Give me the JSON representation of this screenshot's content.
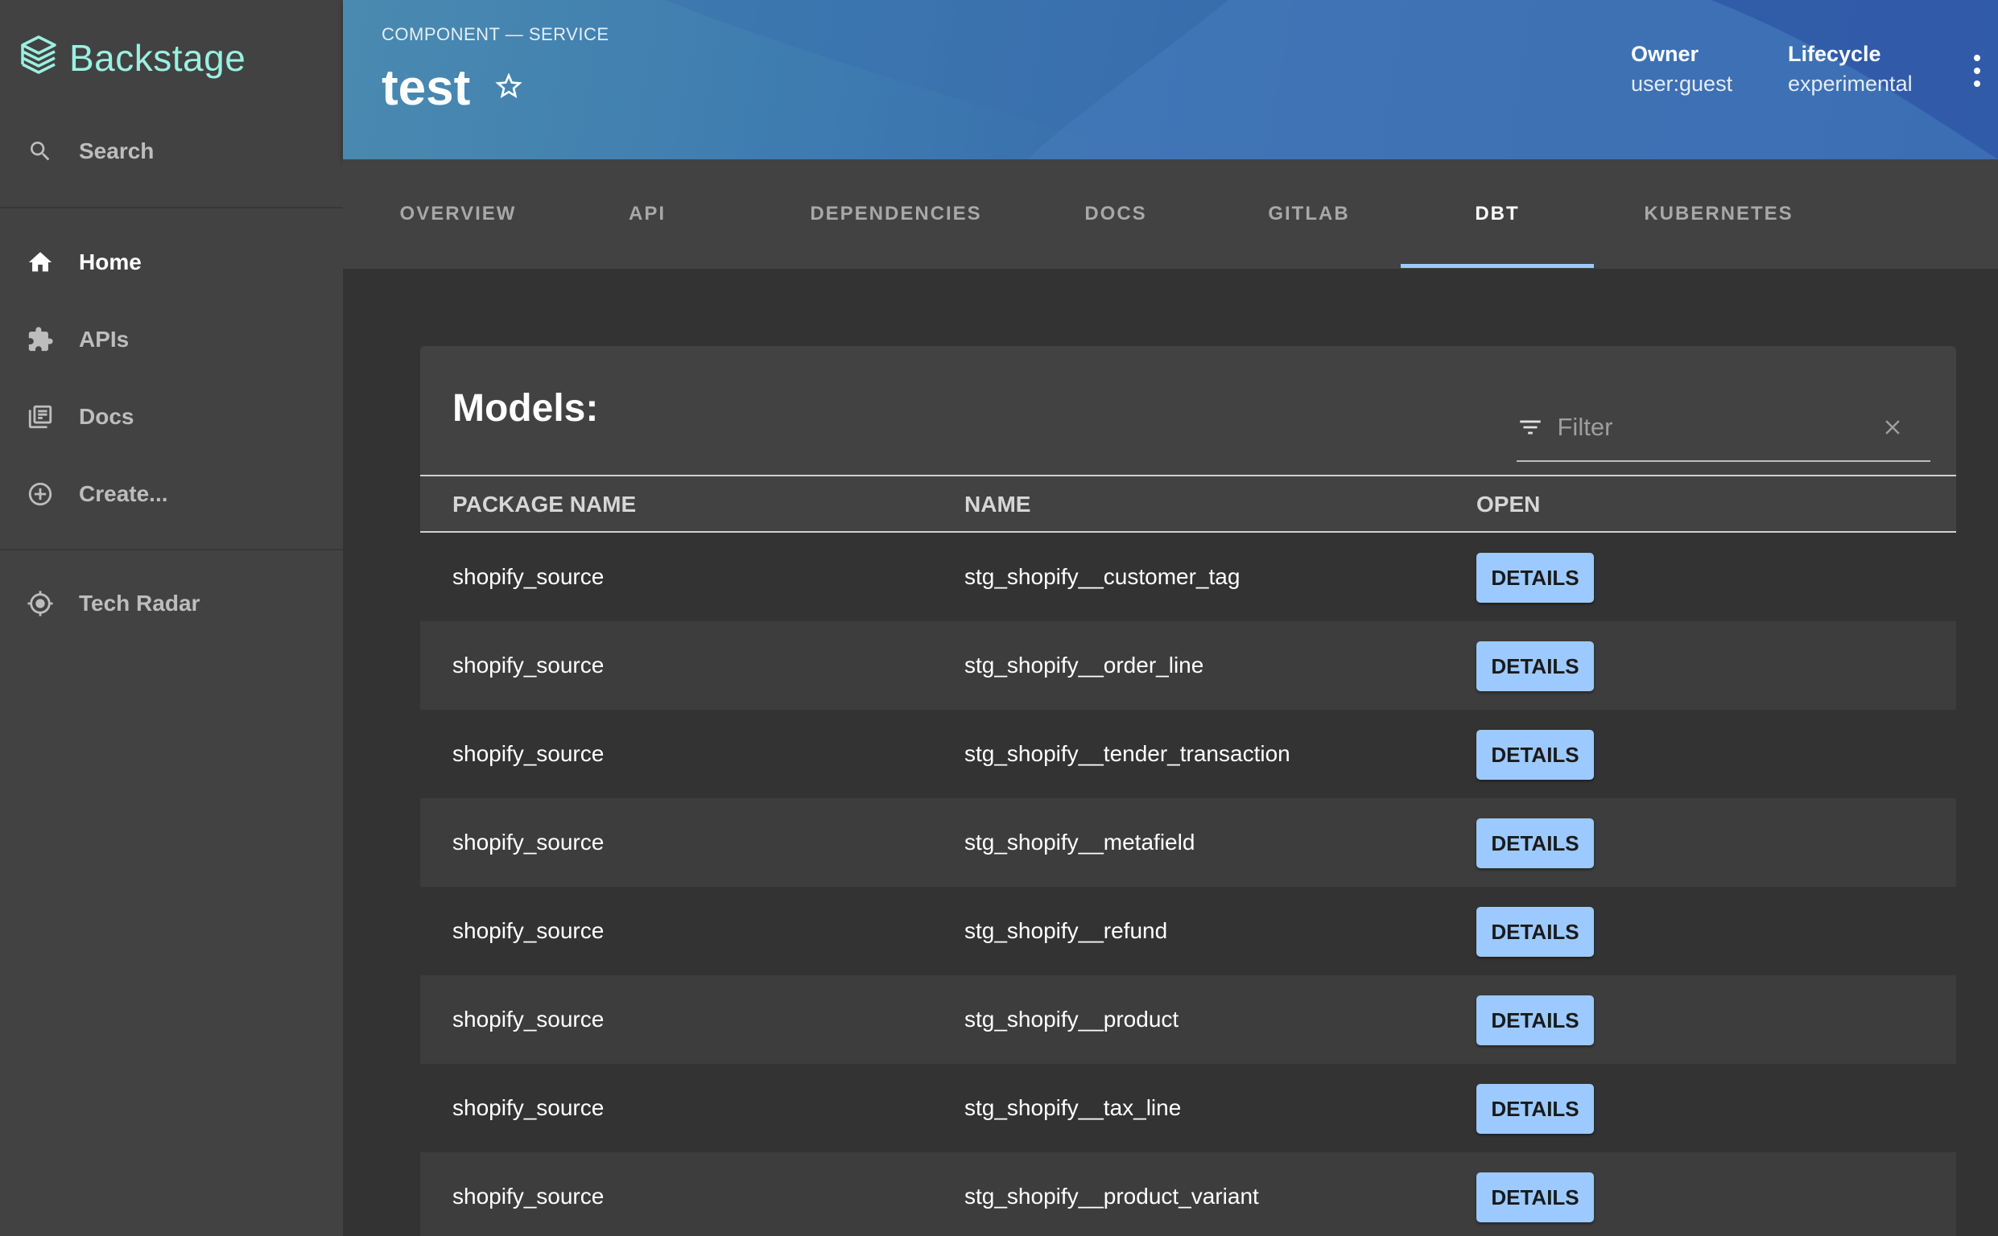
{
  "app": {
    "logo_text": "Backstage"
  },
  "sidebar": {
    "search_label": "Search",
    "items": [
      {
        "label": "Home",
        "icon": "home-icon"
      },
      {
        "label": "APIs",
        "icon": "puzzle-icon"
      },
      {
        "label": "Docs",
        "icon": "library-books-icon"
      },
      {
        "label": "Create...",
        "icon": "add-circle-icon"
      },
      {
        "label": "Tech Radar",
        "icon": "radar-icon"
      }
    ]
  },
  "header": {
    "kind": "COMPONENT — SERVICE",
    "title": "test",
    "owner_label": "Owner",
    "owner_value": "user:guest",
    "lifecycle_label": "Lifecycle",
    "lifecycle_value": "experimental"
  },
  "tabs": [
    {
      "label": "OVERVIEW"
    },
    {
      "label": "API"
    },
    {
      "label": "DEPENDENCIES"
    },
    {
      "label": "DOCS"
    },
    {
      "label": "GITLAB"
    },
    {
      "label": "DBT",
      "active": true
    },
    {
      "label": "KUBERNETES"
    }
  ],
  "models": {
    "title": "Models:",
    "filter_placeholder": "Filter",
    "columns": [
      "PACKAGE NAME",
      "NAME",
      "OPEN"
    ],
    "button_label": "DETAILS",
    "rows": [
      {
        "package": "shopify_source",
        "name": "stg_shopify__customer_tag"
      },
      {
        "package": "shopify_source",
        "name": "stg_shopify__order_line"
      },
      {
        "package": "shopify_source",
        "name": "stg_shopify__tender_transaction"
      },
      {
        "package": "shopify_source",
        "name": "stg_shopify__metafield"
      },
      {
        "package": "shopify_source",
        "name": "stg_shopify__refund"
      },
      {
        "package": "shopify_source",
        "name": "stg_shopify__product"
      },
      {
        "package": "shopify_source",
        "name": "stg_shopify__tax_line"
      },
      {
        "package": "shopify_source",
        "name": "stg_shopify__product_variant"
      }
    ]
  },
  "colors": {
    "accent": "#9cc9ff",
    "logo": "#9bf0e1",
    "sidebar_bg": "#424242",
    "page_bg": "#333333"
  }
}
